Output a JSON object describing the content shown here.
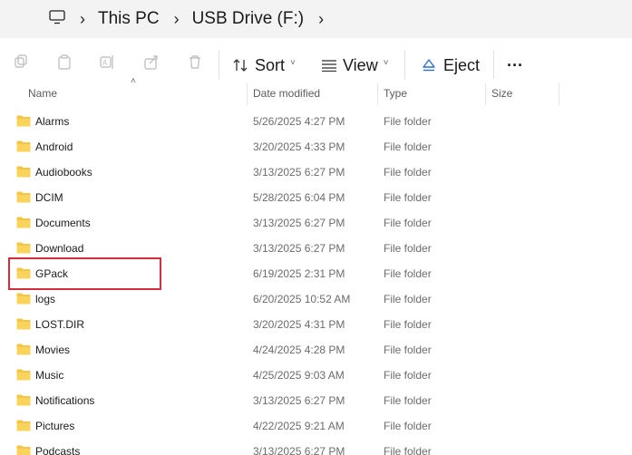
{
  "address": {
    "computer_icon": "computer-icon",
    "crumbs": [
      "This PC",
      "USB Drive (F:)"
    ]
  },
  "toolbar": {
    "icons": [
      "cut-icon",
      "copy-icon",
      "paste-icon",
      "rename-icon",
      "share-icon",
      "delete-icon"
    ],
    "sort_label": "Sort",
    "view_label": "View",
    "eject_label": "Eject",
    "more_label": "···"
  },
  "columns": {
    "name": "Name",
    "date": "Date modified",
    "type": "Type",
    "size": "Size"
  },
  "files": [
    {
      "name": "Alarms",
      "date": "5/26/2025 4:27 PM",
      "type": "File folder"
    },
    {
      "name": "Android",
      "date": "3/20/2025 4:33 PM",
      "type": "File folder"
    },
    {
      "name": "Audiobooks",
      "date": "3/13/2025 6:27 PM",
      "type": "File folder"
    },
    {
      "name": "DCIM",
      "date": "5/28/2025 6:04 PM",
      "type": "File folder"
    },
    {
      "name": "Documents",
      "date": "3/13/2025 6:27 PM",
      "type": "File folder"
    },
    {
      "name": "Download",
      "date": "3/13/2025 6:27 PM",
      "type": "File folder"
    },
    {
      "name": "GPack",
      "date": "6/19/2025 2:31 PM",
      "type": "File folder"
    },
    {
      "name": "logs",
      "date": "6/20/2025 10:52 AM",
      "type": "File folder"
    },
    {
      "name": "LOST.DIR",
      "date": "3/20/2025 4:31 PM",
      "type": "File folder"
    },
    {
      "name": "Movies",
      "date": "4/24/2025 4:28 PM",
      "type": "File folder"
    },
    {
      "name": "Music",
      "date": "4/25/2025 9:03 AM",
      "type": "File folder"
    },
    {
      "name": "Notifications",
      "date": "3/13/2025 6:27 PM",
      "type": "File folder"
    },
    {
      "name": "Pictures",
      "date": "4/22/2025 9:21 AM",
      "type": "File folder"
    },
    {
      "name": "Podcasts",
      "date": "3/13/2025 6:27 PM",
      "type": "File folder"
    }
  ],
  "colors": {
    "folder": "#f4c542",
    "highlight": "#d32f3a",
    "eject_accent": "#2f6fd1"
  }
}
